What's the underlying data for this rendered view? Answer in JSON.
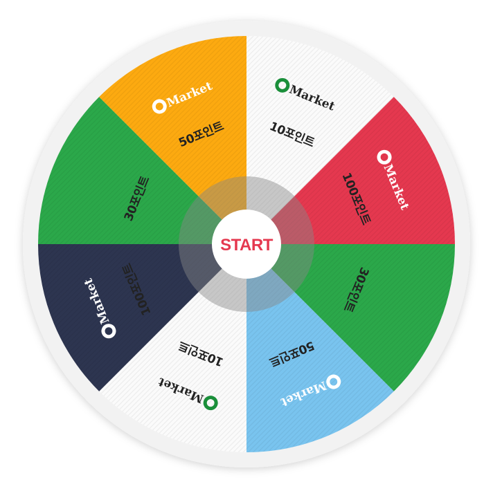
{
  "wheel": {
    "start_label": "START",
    "brand_label": "Market",
    "segments": [
      {
        "label": "10포인트",
        "color": "#fbfbfb",
        "text_color": "#222222",
        "logo": "green"
      },
      {
        "label": "100포인트",
        "color": "#e5384f",
        "text_color": "#222222",
        "logo": "white"
      },
      {
        "label": "30포인트",
        "color": "#2ba84a",
        "text_color": "#222222",
        "logo": "none"
      },
      {
        "label": "50포인트",
        "color": "#79c4ef",
        "text_color": "#222222",
        "logo": "white"
      },
      {
        "label": "10포인트",
        "color": "#fbfbfb",
        "text_color": "#222222",
        "logo": "green"
      },
      {
        "label": "100포인트",
        "color": "#2d3550",
        "text_color": "#222222",
        "logo": "white"
      },
      {
        "label": "30포인트",
        "color": "#2ba84a",
        "text_color": "#222222",
        "logo": "none"
      },
      {
        "label": "50포인트",
        "color": "#fdaa10",
        "text_color": "#222222",
        "logo": "white"
      }
    ],
    "colors": {
      "rim": "#f2f2f2",
      "hub_ring": "#888888",
      "start_text": "#e5384f",
      "brand_green": "#1a8f3a"
    }
  }
}
